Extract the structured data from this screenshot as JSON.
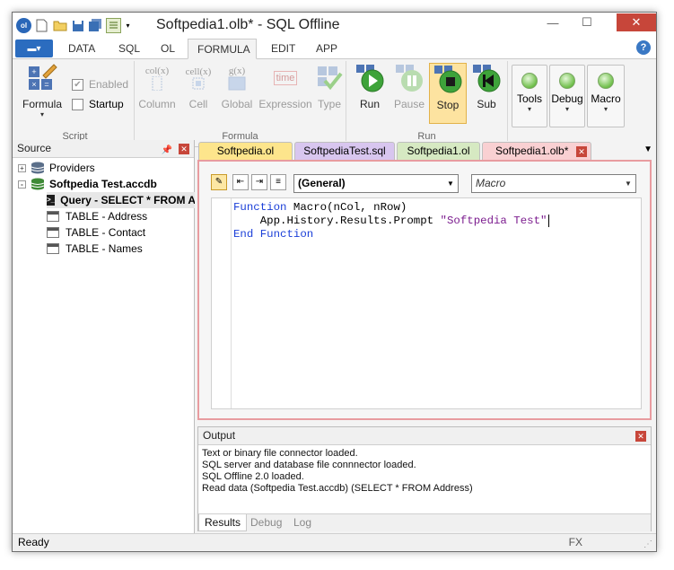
{
  "window": {
    "title": "Softpedia1.olb* - SQL Offline"
  },
  "ribbon_tabs": [
    "DATA",
    "SQL",
    "OL",
    "FORMULA",
    "EDIT",
    "APP"
  ],
  "active_tab": "FORMULA",
  "ribbon": {
    "script": {
      "formula_label": "Formula",
      "enabled_label": "Enabled",
      "enabled_checked": true,
      "startup_label": "Startup",
      "startup_checked": false,
      "group_label": "Script"
    },
    "formula": {
      "buttons": [
        {
          "label": "Column",
          "icon_text": "col(x)"
        },
        {
          "label": "Cell",
          "icon_text": "cell(x)"
        },
        {
          "label": "Global",
          "icon_text": "g(x)"
        },
        {
          "label": "Expression",
          "icon_text": "time"
        },
        {
          "label": "Type",
          "icon_text": ""
        }
      ],
      "group_label": "Formula"
    },
    "run": {
      "buttons": [
        "Run",
        "Pause",
        "Stop",
        "Sub"
      ],
      "group_label": "Run"
    },
    "dropdowns": [
      "Tools",
      "Debug",
      "Macro"
    ]
  },
  "source": {
    "title": "Source",
    "tree": [
      {
        "label": "Providers",
        "level": 0,
        "icon": "database-icon",
        "expander": "+"
      },
      {
        "label": "Softpedia Test.accdb",
        "level": 0,
        "icon": "database-icon",
        "expander": "-"
      },
      {
        "label": "Query - SELECT * FROM Address",
        "level": 1,
        "icon": "query-icon"
      },
      {
        "label": "TABLE - Address",
        "level": 1,
        "icon": "table-icon"
      },
      {
        "label": "TABLE - Contact",
        "level": 1,
        "icon": "table-icon"
      },
      {
        "label": "TABLE - Names",
        "level": 1,
        "icon": "table-icon"
      }
    ]
  },
  "doc_tabs": [
    {
      "label": "Softpedia.ol",
      "color": "#fde58c"
    },
    {
      "label": "SoftpediaTest.sql",
      "color": "#d8c6ef"
    },
    {
      "label": "Softpedia1.ol",
      "color": "#d6e9c2"
    },
    {
      "label": "Softpedia1.olb*",
      "color": "#f9d0d2",
      "active": true
    }
  ],
  "editor": {
    "object_combo": "(General)",
    "proc_combo": "Macro",
    "code": {
      "l1_kw": "Function",
      "l1_rest": " Macro(nCol, nRow)",
      "l2_rest": "    App.History.Results.Prompt ",
      "l2_str": "\"Softpedia Test\"",
      "l3_kw": "End Function"
    }
  },
  "output": {
    "title": "Output",
    "lines": [
      "Text or binary file connector loaded.",
      "SQL server and database file connnector loaded.",
      "SQL Offline 2.0 loaded.",
      "Read data (Softpedia Test.accdb) (SELECT * FROM Address)"
    ],
    "tabs": [
      "Results",
      "Debug",
      "Log"
    ],
    "active_tab": "Results"
  },
  "status": {
    "text": "Ready",
    "fx": "FX"
  }
}
